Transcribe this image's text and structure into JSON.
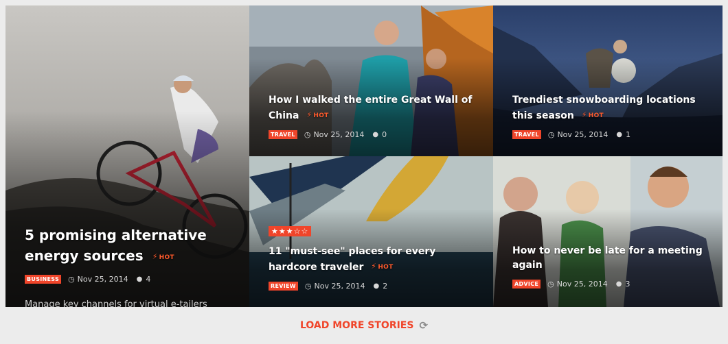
{
  "cards": [
    {
      "title": "5 promising alternative energy sources",
      "hot": "HOT",
      "category": "BUSINESS",
      "date": "Nov 25, 2014",
      "comments": "4",
      "excerpt": "Manage key channels for virtual e-tailers"
    },
    {
      "title": "How I walked the entire Great Wall of China",
      "hot": "HOT",
      "category": "TRAVEL",
      "date": "Nov 25, 2014",
      "comments": "0"
    },
    {
      "title": "Trendiest snowboarding locations this season",
      "hot": "HOT",
      "category": "TRAVEL",
      "date": "Nov 25, 2014",
      "comments": "1"
    },
    {
      "title": "11 \"must-see\" places for every hardcore traveler",
      "hot": "HOT",
      "rating": 3,
      "rating_max": 5,
      "category": "REVIEW",
      "date": "Nov 25, 2014",
      "comments": "2"
    },
    {
      "title": "How to never be late for a meeting again",
      "category": "ADVICE",
      "date": "Nov 25, 2014",
      "comments": "3"
    }
  ],
  "load_more": {
    "label": "LOAD MORE STORIES"
  },
  "colors": {
    "accent": "#f0452a",
    "hot": "#ff5a2c",
    "page_bg": "#ececec"
  },
  "icons": {
    "hot": "lightning-bolt-icon",
    "date": "clock-icon",
    "comments": "speech-bubble-icon",
    "load_more": "refresh-icon",
    "rating": "star-icon"
  }
}
